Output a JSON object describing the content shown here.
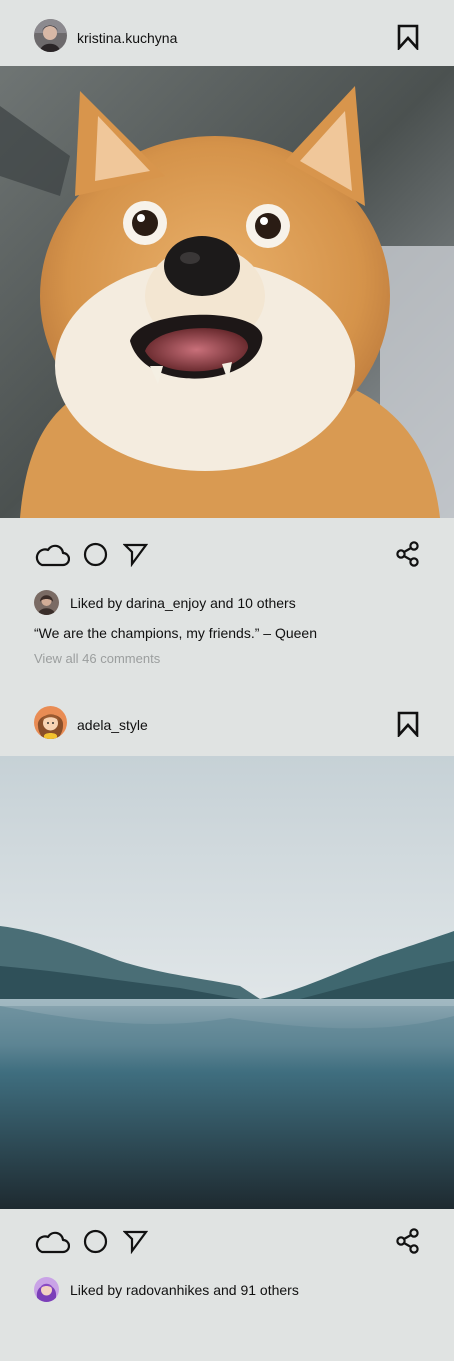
{
  "feed": {
    "posts": [
      {
        "username": "kristina.kuchyna",
        "avatar_icon": "avatar-woman-dark-hair",
        "image_description": "shiba-inu-dog-surprised",
        "likes_text": "Liked by darina_enjoy and 10 others",
        "caption": "“We are the champions, my friends.” – Queen",
        "comments_link": "View all 46 comments"
      },
      {
        "username": "adela_style",
        "avatar_icon": "avatar-cartoon-girl",
        "image_description": "misty-lake-mountains",
        "likes_text": "Liked by radovanhikes and 91 others"
      }
    ]
  },
  "icons": {
    "bookmark": "bookmark-icon",
    "like": "cloud-icon",
    "comment": "circle-icon",
    "send": "send-icon",
    "share": "share-icon"
  },
  "colors": {
    "background": "#e0e3e2",
    "text": "#111111",
    "muted": "#9b9e9e"
  }
}
